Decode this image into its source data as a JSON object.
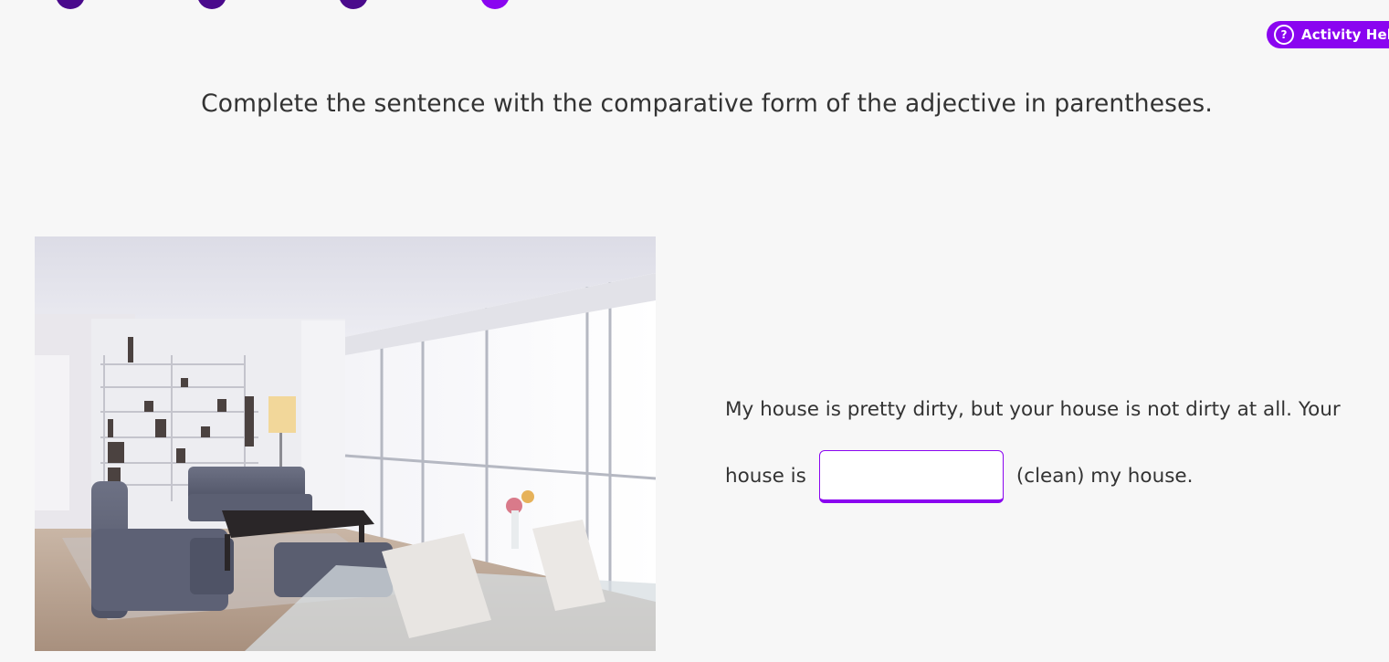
{
  "progress": {
    "steps": [
      {
        "state": "complete"
      },
      {
        "state": "complete"
      },
      {
        "state": "complete"
      },
      {
        "state": "current"
      }
    ]
  },
  "help": {
    "icon": "question-circle-icon",
    "label": "Activity Help"
  },
  "instruction": "Complete the sentence with the comparative form of the adjective in parentheses.",
  "question": {
    "line1": "My house is pretty dirty, but your house is not dirty at all. Your",
    "before_blank": "house is",
    "answer_value": "",
    "after_blank": "(clean) my house."
  },
  "colors": {
    "accent": "#8a05f0",
    "step_complete": "#4a0a8c",
    "background": "#f7f7f7",
    "text": "#333333"
  }
}
